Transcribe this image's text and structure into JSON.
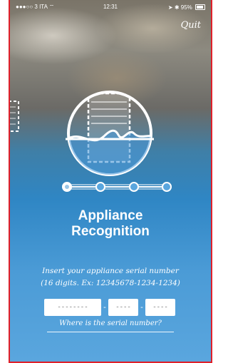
{
  "status_bar": {
    "carrier": "3 ITA",
    "time": "12:31",
    "battery": "95%"
  },
  "header": {
    "quit_label": "Quit"
  },
  "progress": {
    "total_steps": 4,
    "current_step": 1
  },
  "title": {
    "line1": "Appliance",
    "line2": "Recognition"
  },
  "instructions": {
    "line1": "Insert your appliance serial number",
    "line2": "(16 digits. Ex: 12345678-1234-1234)"
  },
  "serial_form": {
    "part1_placeholder": "--------",
    "part2_placeholder": "----",
    "part3_placeholder": "----",
    "separator": "-"
  },
  "help_link": {
    "label": "Where is the serial number?"
  },
  "colors": {
    "accent": "#2f86c4",
    "frame_border": "#e0202a",
    "text": "#ffffff"
  },
  "icons": [
    "wifi-icon",
    "location-icon",
    "bluetooth-icon",
    "battery-icon",
    "folded-laundry-icon",
    "washing-machine-water-icon"
  ]
}
